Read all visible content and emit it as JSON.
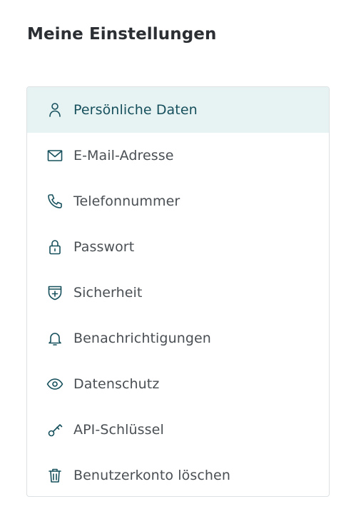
{
  "page": {
    "title": "Meine Einstellungen"
  },
  "colors": {
    "accent": "#16505c",
    "active_background": "#e7f2f3",
    "border": "#dde1e4",
    "text": "#4a4f54"
  },
  "menu": {
    "active_index": 0,
    "items": [
      {
        "label": "Persönliche Daten",
        "icon": "user-icon"
      },
      {
        "label": "E-Mail-Adresse",
        "icon": "mail-icon"
      },
      {
        "label": "Telefonnummer",
        "icon": "phone-icon"
      },
      {
        "label": "Passwort",
        "icon": "lock-icon"
      },
      {
        "label": "Sicherheit",
        "icon": "shield-plus-icon"
      },
      {
        "label": "Benachrichtigungen",
        "icon": "bell-icon"
      },
      {
        "label": "Datenschutz",
        "icon": "eye-icon"
      },
      {
        "label": "API-Schlüssel",
        "icon": "key-icon"
      },
      {
        "label": "Benutzerkonto löschen",
        "icon": "trash-icon"
      }
    ]
  }
}
